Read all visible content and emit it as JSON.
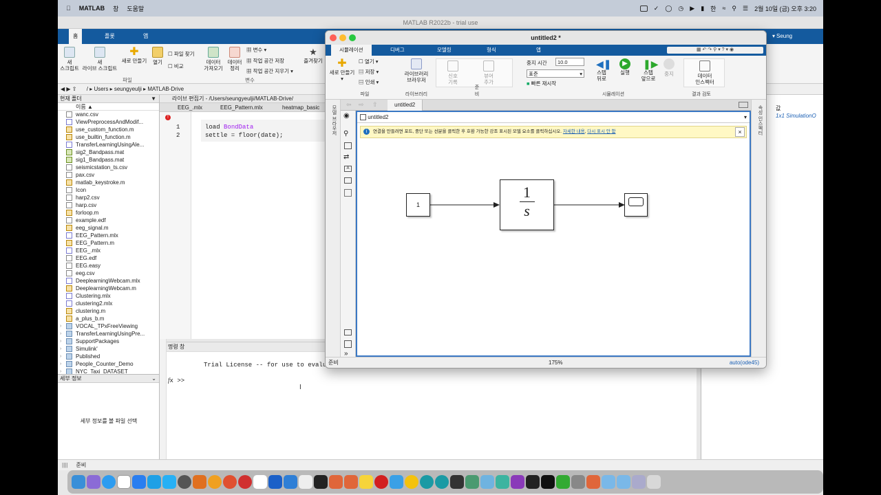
{
  "mac_menubar": {
    "app": "MATLAB",
    "menu1": "창",
    "menu2": "도움말",
    "datetime": "2월 10일 (금) 오후 3:20",
    "input_lang": "한"
  },
  "matlab": {
    "window_title": "MATLAB R2022b - trial use",
    "tabs": [
      "홈",
      "플롯",
      "앱"
    ],
    "user": "Seung Yeulji",
    "ribbon": {
      "new_script": "새\n스크립트",
      "new_live_script": "새\n라이브 스크립트",
      "new": "새로 만들기",
      "open": "열기",
      "find_files": "파일 찾기",
      "compare": "비교",
      "import_data": "데이터\n가져오기",
      "clean_data": "데이터\n정리",
      "variable": "변수",
      "save_workspace": "작업 공간 저장",
      "clear_workspace": "작업 공간 지우기",
      "favorites": "즐겨찾기",
      "group_file": "파일",
      "group_variable": "변수"
    },
    "path": [
      "Users",
      "seungyeulji",
      "MATLAB-Drive"
    ],
    "current_folder_title": "현재 폴더",
    "name_column": "이름",
    "files": [
      {
        "name": "wanc.csv",
        "type": "csv"
      },
      {
        "name": "ViewPreprocessAndModif...",
        "type": "mlx"
      },
      {
        "name": "use_custom_function.m",
        "type": "m"
      },
      {
        "name": "use_builtin_function.m",
        "type": "m"
      },
      {
        "name": "TransferLearningUsingAle...",
        "type": "mlx"
      },
      {
        "name": "sig2_Bandpass.mat",
        "type": "mat"
      },
      {
        "name": "sig1_Bandpass.mat",
        "type": "mat"
      },
      {
        "name": "seismicstation_ts.csv",
        "type": "csv"
      },
      {
        "name": "pax.csv",
        "type": "csv"
      },
      {
        "name": "matlab_keystroke.m",
        "type": "m"
      },
      {
        "name": "Icon",
        "type": "csv"
      },
      {
        "name": "harp2.csv",
        "type": "csv"
      },
      {
        "name": "harp.csv",
        "type": "csv"
      },
      {
        "name": "forloop.m",
        "type": "m"
      },
      {
        "name": "example.edf",
        "type": "csv"
      },
      {
        "name": "eeg_signal.m",
        "type": "m"
      },
      {
        "name": "EEG_Pattern.mlx",
        "type": "mlx"
      },
      {
        "name": "EEG_Pattern.m",
        "type": "m"
      },
      {
        "name": "EEG_.mlx",
        "type": "mlx"
      },
      {
        "name": "EEG.edf",
        "type": "csv"
      },
      {
        "name": "EEG.easy",
        "type": "csv"
      },
      {
        "name": "eeg.csv",
        "type": "csv"
      },
      {
        "name": "DeeplearningWebcam.mlx",
        "type": "mlx"
      },
      {
        "name": "DeeplearningWebcam.m",
        "type": "m"
      },
      {
        "name": "Clustering.mlx",
        "type": "mlx"
      },
      {
        "name": "clustering2.mlx",
        "type": "mlx"
      },
      {
        "name": "clustering.m",
        "type": "m"
      },
      {
        "name": "a_plus_b.m",
        "type": "m"
      },
      {
        "name": "VOCAL_TPxFreeViewing",
        "type": "fold"
      },
      {
        "name": "TransferLearningUsingPre...",
        "type": "fold"
      },
      {
        "name": "SupportPackages",
        "type": "fold"
      },
      {
        "name": "Simulink'",
        "type": "fold"
      },
      {
        "name": "Published",
        "type": "fold"
      },
      {
        "name": "People_Counter_Demo",
        "type": "fold"
      },
      {
        "name": "NYC_Taxi_DATASET",
        "type": "fold"
      }
    ],
    "details_title": "세부 정보",
    "details_hint": "세부 정보를 볼 파일 선택",
    "editor_title": "라이브 편집기 - /Users/seungyeulji/MATLAB-Drive/",
    "editor_tabs": [
      "EEG_.mlx",
      "EEG_Pattern.mlx",
      "heatmap_basic"
    ],
    "code_lines": [
      {
        "num": "1",
        "kw": "load",
        "rest": "BondData"
      },
      {
        "num": "2",
        "kw": "",
        "rest": "settle = floor(date);"
      }
    ],
    "command_title": "명령 창",
    "command_output": "Trial License -- for use to evaluat",
    "prompt": ">>",
    "workspace_value_header": "값",
    "workspace_value": "1x1 SimulationO",
    "status": "준비"
  },
  "simulink": {
    "title": "untitled2 *",
    "tabs": [
      "시뮬레이션",
      "디버그",
      "모델링",
      "형식",
      "앱"
    ],
    "ribbon": {
      "new": "새로 만들기",
      "open": "열기",
      "save": "저장",
      "print": "인쇄",
      "library_browser": "라이브러리\n브라우저",
      "log_signals": "신호\n기록",
      "add_viewer": "뷰어\n추가",
      "stop_time_label": "중지 시간",
      "stop_time": "10.0",
      "mode": "표준",
      "fast_restart": "빠른 재시작",
      "step_back": "스텝\n뒤로",
      "run": "실행",
      "step_forward": "스텝\n앞으로",
      "stop": "중지",
      "data_inspector": "데이터\n인스펙터",
      "group_file": "파일",
      "group_library": "라이브러리",
      "group_prepare": "준비",
      "group_simulate": "시뮬레이션",
      "group_review": "결과 검토"
    },
    "model_tab": "untitled2",
    "breadcrumb": "untitled2",
    "info_banner": "연결을 만들려면 포트, 중단 또는 선분을 클릭한 후 호환 가능한 강조 표시된 모델 요소를 클릭하십시오.",
    "info_link1": "자세한 내용",
    "info_link2": "다시 표시 안 함",
    "constant_value": "1",
    "integrator_num": "1",
    "integrator_den": "s",
    "left_vertical": "모델 브라우저",
    "right_vertical": "속성 인스펙터",
    "status_ready": "준비",
    "zoom": "175%",
    "solver": "auto(ode45)"
  }
}
